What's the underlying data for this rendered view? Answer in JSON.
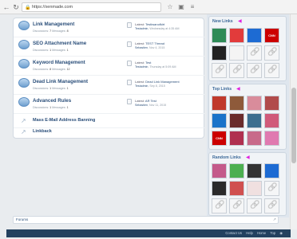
{
  "browser": {
    "url": "https://xenmade.com"
  },
  "forums": [
    {
      "title": "Link Management",
      "discussions": "7",
      "messages": "8",
      "latest_thread": "Testiwanofkirt",
      "latest_user": "Testadmin",
      "latest_date": "Wednesday at 4:35 AM"
    },
    {
      "title": "SEO Attachment Name",
      "discussions": "1",
      "messages": "1",
      "latest_thread": "TEST Thread",
      "latest_user": "Sebastien",
      "latest_date": "Nov 4, 2015"
    },
    {
      "title": "Keyword Management",
      "discussions": "8",
      "messages": "12",
      "latest_thread": "Test",
      "latest_user": "Testadmin",
      "latest_date": "Thursday at 5:09 AM"
    },
    {
      "title": "Dead Link Management",
      "discussions": "1",
      "messages": "1",
      "latest_thread": "Dead Link Management",
      "latest_user": "Testadmin",
      "latest_date": "Sep 8, 2015"
    },
    {
      "title": "Advanced Rules",
      "discussions": "1",
      "messages": "1",
      "latest_thread": "AR Test",
      "latest_user": "Sebastien",
      "latest_date": "Nov 11, 2015"
    }
  ],
  "simple_links": [
    "Mass E-Mail Address Banning",
    "Linkback"
  ],
  "labels": {
    "discussions": "Discussions:",
    "messages": "Messages:",
    "latest": "Latest:"
  },
  "sidebar": {
    "new_links": {
      "title": "New Links",
      "tiles": [
        {
          "kind": "image",
          "color": "#2e8b57"
        },
        {
          "kind": "image",
          "color": "#e23b3b"
        },
        {
          "kind": "image",
          "color": "#1d6bd3"
        },
        {
          "kind": "logo",
          "text": "CNN",
          "color": "#cc0000"
        },
        {
          "kind": "image",
          "color": "#222222"
        },
        {
          "kind": "image",
          "color": "#f4f4f4"
        },
        {
          "kind": "placeholder"
        },
        {
          "kind": "placeholder"
        },
        {
          "kind": "placeholder"
        },
        {
          "kind": "placeholder"
        },
        {
          "kind": "placeholder"
        },
        {
          "kind": "placeholder"
        }
      ]
    },
    "top_links": {
      "title": "Top Links",
      "tiles": [
        {
          "kind": "image",
          "color": "#c0392b"
        },
        {
          "kind": "image",
          "color": "#8e5a3a"
        },
        {
          "kind": "image",
          "color": "#d98c9b"
        },
        {
          "kind": "image",
          "color": "#b14b4b"
        },
        {
          "kind": "image",
          "color": "#1a73c9"
        },
        {
          "kind": "image",
          "color": "#6a2b2b"
        },
        {
          "kind": "image",
          "color": "#3c6e8f"
        },
        {
          "kind": "image",
          "color": "#d05a7a"
        },
        {
          "kind": "logo",
          "text": "CNN",
          "color": "#cc0000"
        },
        {
          "kind": "image",
          "color": "#b03050"
        },
        {
          "kind": "image",
          "color": "#c86a8a"
        },
        {
          "kind": "image",
          "color": "#e07ab0"
        }
      ]
    },
    "random_links": {
      "title": "Random Links",
      "tiles": [
        {
          "kind": "image",
          "color": "#c45a8a"
        },
        {
          "kind": "image",
          "color": "#4caf50"
        },
        {
          "kind": "image",
          "color": "#333333"
        },
        {
          "kind": "image",
          "color": "#1d6bd3"
        },
        {
          "kind": "image",
          "color": "#2a2a2a"
        },
        {
          "kind": "image",
          "color": "#d05050"
        },
        {
          "kind": "image",
          "color": "#f0e0e0"
        },
        {
          "kind": "placeholder"
        },
        {
          "kind": "placeholder"
        },
        {
          "kind": "placeholder"
        },
        {
          "kind": "placeholder"
        },
        {
          "kind": "placeholder"
        }
      ]
    }
  },
  "breadcrumb": {
    "label": "Forums"
  },
  "footer": {
    "links": [
      "Contact Us",
      "Help",
      "Home",
      "Top"
    ]
  }
}
